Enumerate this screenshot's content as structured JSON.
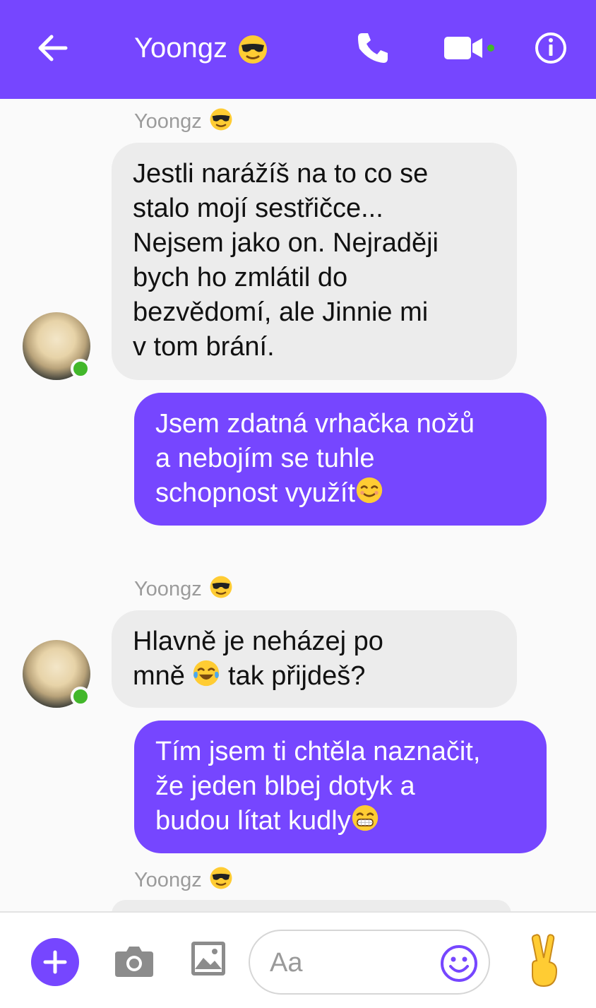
{
  "header": {
    "title": "Yoongz",
    "accent": "#7646ff",
    "icons": [
      "back-arrow-icon",
      "sunglasses-emoji",
      "phone-icon",
      "video-camera-icon",
      "info-icon"
    ]
  },
  "messages": [
    {
      "type": "sender",
      "name": "Yoongz"
    },
    {
      "type": "in",
      "lines": [
        "Jestli narážíš na to co se",
        "stalo mojí sestřičce...",
        "Nejsem jako on. Nejraději",
        "bych ho zmlátil do",
        "bezvědomí, ale Jinnie mi",
        "v tom brání."
      ]
    },
    {
      "type": "out",
      "lines": [
        "Jsem zdatná vrhačka nožů",
        "a nebojím se tuhle",
        "schopnost využít"
      ],
      "emoji": "smiling-relieved-emoji"
    },
    {
      "type": "sender",
      "name": "Yoongz"
    },
    {
      "type": "in",
      "line1": "Hlavně je neházej po",
      "line2_pre": "mně",
      "line2_post": "tak přijdeš?",
      "emoji": "tears-of-joy-emoji"
    },
    {
      "type": "out",
      "lines": [
        "Tím jsem ti chtěla naznačit,",
        "že jeden blbej dotyk a",
        "budou lítat kudly"
      ],
      "emoji": "grinning-emoji"
    },
    {
      "type": "sender",
      "name": "Yoongz"
    }
  ],
  "footer": {
    "placeholder": "Aa",
    "icons": [
      "plus-icon",
      "camera-icon",
      "image-icon",
      "smiley-icon",
      "peace-hand-icon"
    ]
  }
}
